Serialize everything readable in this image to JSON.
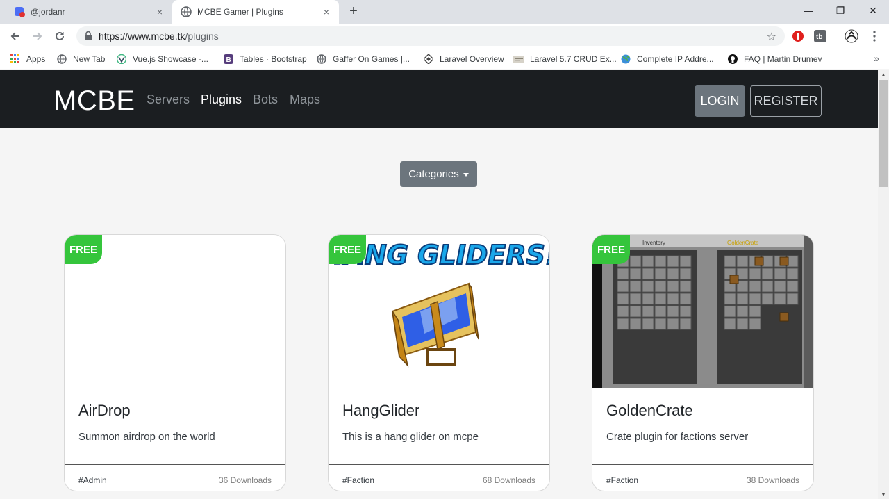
{
  "tabs": [
    {
      "title": "@jordanr",
      "close": "×"
    },
    {
      "title": "MCBE Gamer | Plugins",
      "close": "×"
    }
  ],
  "new_tab": "+",
  "window_controls": {
    "minimize": "—",
    "restore": "❐",
    "close": "✕"
  },
  "address": {
    "scheme_host": "https://www.mcbe.tk",
    "path": "/plugins"
  },
  "bookmarks": [
    {
      "label": "Apps",
      "icon": "apps-grid-icon"
    },
    {
      "label": "New Tab",
      "icon": "globe-icon"
    },
    {
      "label": "Vue.js Showcase -...",
      "icon": "vue-icon"
    },
    {
      "label": "Tables · Bootstrap",
      "icon": "bootstrap-icon"
    },
    {
      "label": "Gaffer On Games |...",
      "icon": "globe-icon"
    },
    {
      "label": "Laravel Overview",
      "icon": "laravel-icon"
    },
    {
      "label": "Laravel 5.7 CRUD Ex...",
      "icon": "site-thumbnail-icon"
    },
    {
      "label": "Complete IP Addre...",
      "icon": "earth-icon"
    },
    {
      "label": "FAQ | Martin Drumev",
      "icon": "github-icon"
    }
  ],
  "site": {
    "brand": "MCBE",
    "nav": [
      "Servers",
      "Plugins",
      "Bots",
      "Maps"
    ],
    "active_nav": "Plugins",
    "login": "LOGIN",
    "register": "REGISTER",
    "categories": "Categories"
  },
  "plugins": [
    {
      "badge": "FREE",
      "name": "AirDrop",
      "description": "Summon airdrop on the world",
      "tag": "#Admin",
      "downloads": "36 Downloads"
    },
    {
      "badge": "FREE",
      "name": "HangGlider",
      "description": "This is a hang glider on mcpe",
      "tag": "#Faction",
      "downloads": "68 Downloads",
      "banner": "HANG GLIDERS!"
    },
    {
      "badge": "FREE",
      "name": "GoldenCrate",
      "description": "Crate plugin for factions server",
      "tag": "#Faction",
      "downloads": "38 Downloads",
      "screen_left": "Inventory",
      "screen_right": "GoldenCrate"
    }
  ],
  "colors": {
    "navbar": "#1b1e21",
    "badge": "#35c53c",
    "secondary": "#6c757d"
  }
}
